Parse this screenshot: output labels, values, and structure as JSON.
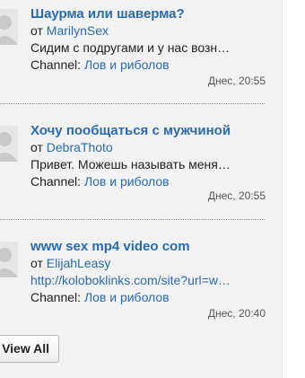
{
  "posts": [
    {
      "title": "Шаурма или шаверма?",
      "from_label": "от",
      "author": "MarilynSex",
      "body_lines": [
        "Сидим с подругами и у нас возн…"
      ],
      "channel_label": "Channel:",
      "channel": "Лов и риболов",
      "time": "Днес, 20:55"
    },
    {
      "title": "Хочу пообщаться с мужчиной",
      "from_label": "от",
      "author": "DebraThoto",
      "body_lines": [
        "Привет. Можешь называть меня…"
      ],
      "channel_label": "Channel:",
      "channel": "Лов и риболов",
      "time": "Днес, 20:55"
    },
    {
      "title": "www sex mp4 video com",
      "from_label": "от",
      "author": "ElijahLeasy",
      "body_lines": [
        "http://koloboklinks.com/site?url=w…"
      ],
      "channel_label": "Channel:",
      "channel": "Лов и риболов",
      "time": "Днес, 20:40"
    }
  ],
  "view_all_label": "View All",
  "colors": {
    "link": "#2a6ab0",
    "panel_bg": "#f2f2f2",
    "text": "#222222",
    "time": "#555555"
  },
  "icons": {
    "avatar": "default-user-silhouette"
  }
}
